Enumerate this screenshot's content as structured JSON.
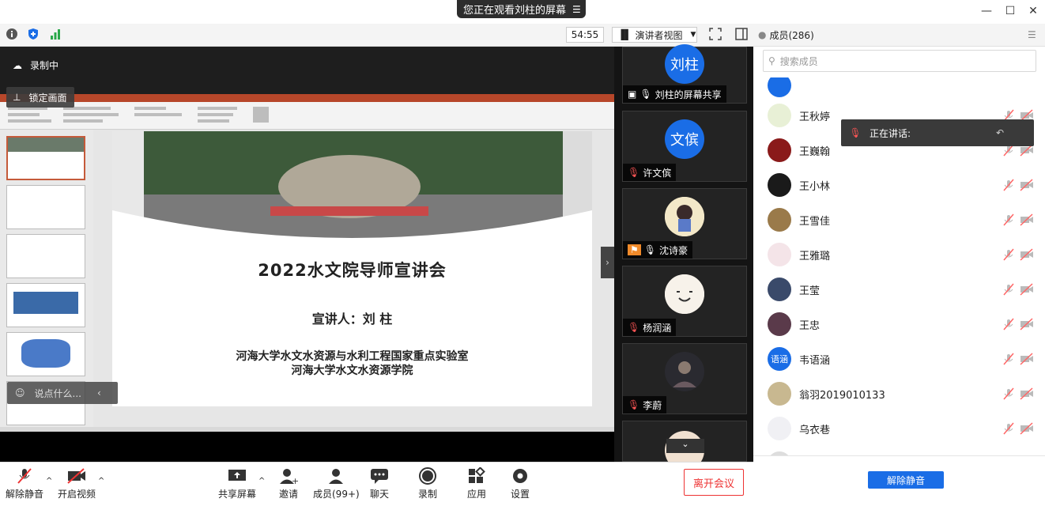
{
  "banner": {
    "text": "您正在观看刘柱的屏幕"
  },
  "toolbar": {
    "timer": "54:55",
    "view_label": "演讲者视图"
  },
  "stage": {
    "recording_label": "录制中",
    "lock_label": "锁定画面",
    "chat_placeholder": "说点什么..."
  },
  "slide": {
    "title": "2022水文院导师宣讲会",
    "speaker": "宣讲人：刘 柱",
    "org1": "河海大学水文水资源与水利工程国家重点实验室",
    "org2": "河海大学水文水资源学院"
  },
  "gallery": [
    {
      "avatar": "刘柱",
      "name": "刘柱的屏幕共享",
      "color": "#1a6de6"
    },
    {
      "avatar": "文傧",
      "name": "许文傧",
      "color": "#1a6de6"
    },
    {
      "avatar": "",
      "name": "沈诗豪",
      "color": "#f3e8c8"
    },
    {
      "avatar": "",
      "name": "杨润涵",
      "color": "#f7f2ea"
    },
    {
      "avatar": "",
      "name": "李蔚",
      "color": "#222"
    }
  ],
  "bottom": {
    "unmute": "解除静音",
    "video": "开启视频",
    "share": "共享屏幕",
    "invite": "邀请",
    "members": "成员(99+)",
    "chat": "聊天",
    "record": "录制",
    "apps": "应用",
    "settings": "设置",
    "leave": "离开会议"
  },
  "panel": {
    "title": "成员(286)",
    "search_placeholder": "搜索成员",
    "speaking_label": "正在讲话:",
    "unmute_all": "解除静音",
    "members": [
      {
        "name": "王秋婷",
        "avatar_color": "#e8f0d6",
        "avatar_text": ""
      },
      {
        "name": "王巍翰",
        "avatar_color": "#8a1a1a",
        "avatar_text": ""
      },
      {
        "name": "王小林",
        "avatar_color": "#1a1a1a",
        "avatar_text": ""
      },
      {
        "name": "王雪佳",
        "avatar_color": "#9a7a4a",
        "avatar_text": ""
      },
      {
        "name": "王雅璐",
        "avatar_color": "#f4e4e8",
        "avatar_text": ""
      },
      {
        "name": "王莹",
        "avatar_color": "#3a4a6a",
        "avatar_text": ""
      },
      {
        "name": "王忠",
        "avatar_color": "#5a3a4a",
        "avatar_text": ""
      },
      {
        "name": "韦语涵",
        "avatar_color": "#1a6de6",
        "avatar_text": "语涵"
      },
      {
        "name": "翁羽2019010133",
        "avatar_color": "#c8b890",
        "avatar_text": ""
      },
      {
        "name": "乌衣巷",
        "avatar_color": "#f0f0f4",
        "avatar_text": ""
      }
    ]
  }
}
